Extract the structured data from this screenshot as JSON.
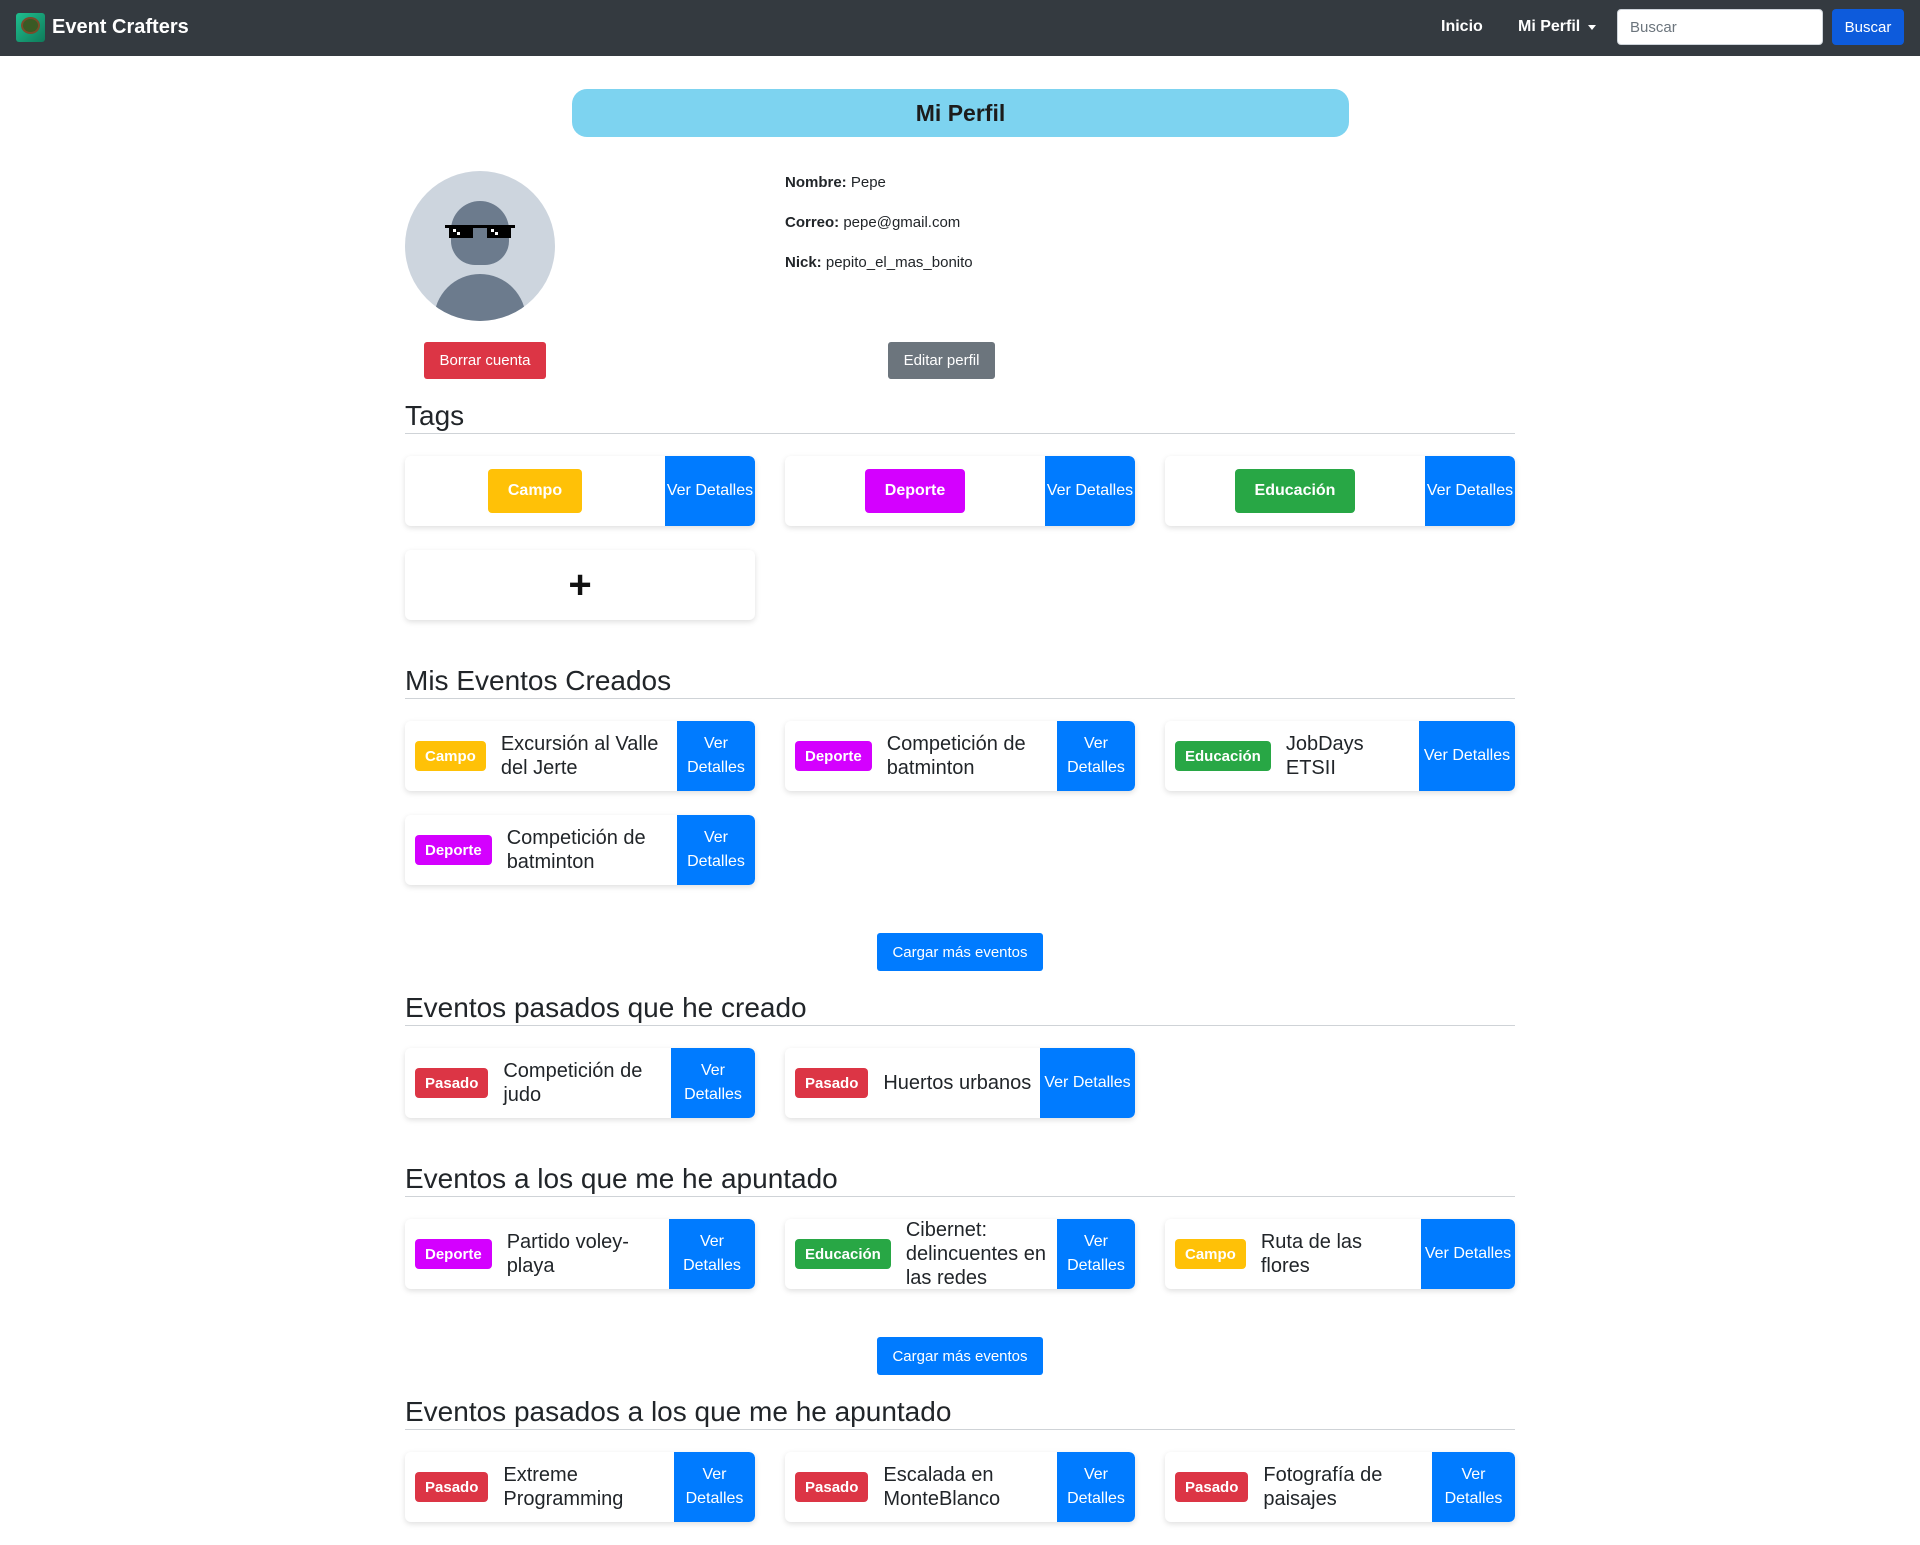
{
  "nav": {
    "brand": "Event Crafters",
    "inicio": "Inicio",
    "perfil": "Mi Perfil",
    "search_placeholder": "Buscar",
    "search_button": "Buscar"
  },
  "page_title": "Mi Perfil",
  "profile": {
    "nombre_label": "Nombre:",
    "nombre": "Pepe",
    "correo_label": "Correo:",
    "correo": "pepe@gmail.com",
    "nick_label": "Nick:",
    "nick": "pepito_el_mas_bonito",
    "delete_button": "Borrar cuenta",
    "edit_button": "Editar perfil"
  },
  "colors": {
    "campo": "#ffc107",
    "deporte": "#d400ff",
    "educacion": "#28a745",
    "pasado": "#dc3545",
    "primary": "#007bff"
  },
  "tags": {
    "heading": "Tags",
    "items": [
      {
        "label": "Campo",
        "color": "#ffc107",
        "action": "Ver Detalles"
      },
      {
        "label": "Deporte",
        "color": "#d400ff",
        "action": "Ver Detalles"
      },
      {
        "label": "Educación",
        "color": "#28a745",
        "action": "Ver Detalles"
      }
    ],
    "add_label": "+"
  },
  "created": {
    "heading": "Mis Eventos Creados",
    "items": [
      {
        "badge": "Campo",
        "color": "#ffc107",
        "title": "Excursión al Valle del Jerte",
        "action": "Ver Detalles"
      },
      {
        "badge": "Deporte",
        "color": "#d400ff",
        "title": "Competición de batminton",
        "action": "Ver Detalles"
      },
      {
        "badge": "Educación",
        "color": "#28a745",
        "title": "JobDays ETSII",
        "action": "Ver Detalles"
      },
      {
        "badge": "Deporte",
        "color": "#d400ff",
        "title": "Competición de batminton",
        "action": "Ver Detalles"
      }
    ],
    "load_more": "Cargar más eventos"
  },
  "past_created": {
    "heading": "Eventos pasados que he creado",
    "items": [
      {
        "badge": "Pasado",
        "color": "#dc3545",
        "title": "Competición de judo",
        "action": "Ver Detalles"
      },
      {
        "badge": "Pasado",
        "color": "#dc3545",
        "title": "Huertos urbanos",
        "action": "Ver Detalles"
      }
    ]
  },
  "joined": {
    "heading": "Eventos a los que me he apuntado",
    "items": [
      {
        "badge": "Deporte",
        "color": "#d400ff",
        "title": "Partido voley-playa",
        "action": "Ver Detalles"
      },
      {
        "badge": "Educación",
        "color": "#28a745",
        "title": "Cibernet: delincuentes en las redes",
        "action": "Ver Detalles"
      },
      {
        "badge": "Campo",
        "color": "#ffc107",
        "title": "Ruta de las flores",
        "action": "Ver Detalles"
      }
    ],
    "load_more": "Cargar más eventos"
  },
  "past_joined": {
    "heading": "Eventos pasados a los que me he apuntado",
    "items": [
      {
        "badge": "Pasado",
        "color": "#dc3545",
        "title": "Extreme Programming",
        "action": "Ver Detalles"
      },
      {
        "badge": "Pasado",
        "color": "#dc3545",
        "title": "Escalada en MonteBlanco",
        "action": "Ver Detalles"
      },
      {
        "badge": "Pasado",
        "color": "#dc3545",
        "title": "Fotografía de paisajes",
        "action": "Ver Detalles"
      }
    ]
  }
}
